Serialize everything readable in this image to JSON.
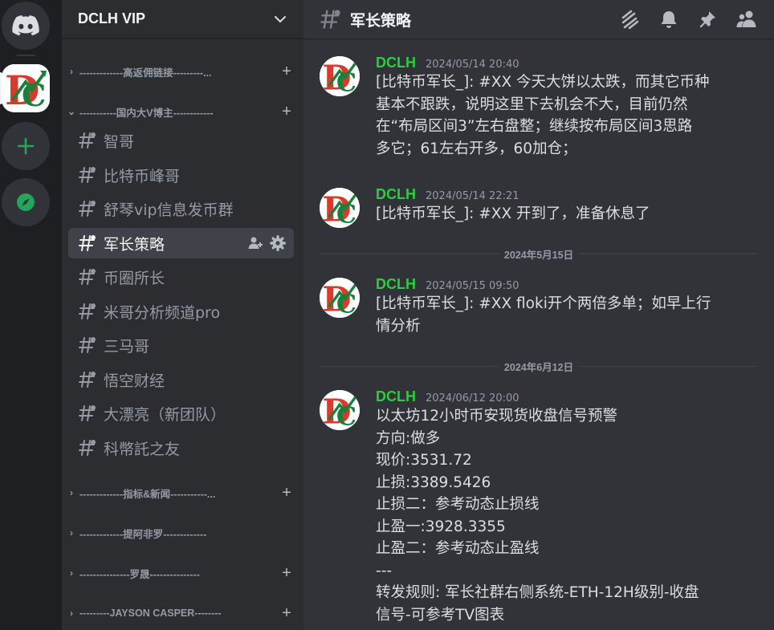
{
  "colors": {
    "accent_green": "#23a55a",
    "author_green": "#2ecc40"
  },
  "rail": {
    "items": [
      {
        "icon": "discord-icon"
      },
      {
        "icon": "server-dclh-logo"
      },
      {
        "icon": "add-server-icon"
      },
      {
        "icon": "explore-compass-icon"
      }
    ]
  },
  "guild": {
    "name": "DCLH VIP",
    "menu_icon": "chevron-down-icon"
  },
  "categories": [
    {
      "label": "-------------高返佣链接---------..."
    },
    {
      "label": "-----------国内大V博主------------"
    },
    {
      "label": "-------------指标&新闻-----------..."
    },
    {
      "label": "-------------提阿非罗-------------"
    },
    {
      "label": "---------------罗晟---------------"
    },
    {
      "label": "---------JAYSON CASPER--------"
    }
  ],
  "channels": [
    {
      "label": "智哥"
    },
    {
      "label": "比特币峰哥"
    },
    {
      "label": "舒琴vip信息发币群"
    },
    {
      "label": "军长策略"
    },
    {
      "label": "币圈所长"
    },
    {
      "label": "米哥分析频道pro"
    },
    {
      "label": "三马哥"
    },
    {
      "label": "悟空财经"
    },
    {
      "label": "大漂亮（新团队）"
    },
    {
      "label": "科幣託之友"
    }
  ],
  "topbar": {
    "title": "军长策略",
    "icons": [
      "threads-icon",
      "notification-bell-icon",
      "pin-icon",
      "member-list-icon"
    ]
  },
  "messages": [
    {
      "author": "DCLH",
      "timestamp": "2024/05/14 20:40",
      "lines": [
        "[比特币军长_]: #XX 今天大饼以太跌，而其它币种",
        "基本不跟跌，说明这里下去机会不大，目前仍然",
        "在“布局区间3”左右盘整；继续按布局区间3思路",
        "多它；61左右开多，60加仓；"
      ]
    },
    {
      "author": "DCLH",
      "timestamp": "2024/05/14 22:21",
      "lines": [
        "[比特币军长_]: #XX 开到了，准备休息了"
      ]
    },
    {
      "author": "DCLH",
      "timestamp": "2024/05/15 09:50",
      "lines": [
        "[比特币军长_]: #XX floki开个两倍多单；如早上行",
        "情分析"
      ]
    },
    {
      "author": "DCLH",
      "timestamp": "2024/06/12 20:00",
      "lines": [
        "以太坊12小时币安现货收盘信号预警",
        "方向:做多",
        "现价:3531.72",
        "止损:3389.5426",
        "止损二：参考动态止损线",
        "止盈一:3928.3355",
        "止盈二：参考动态止盈线",
        "---",
        "转发规则: 军长社群右侧系统-ETH-12H级别-收盘",
        "信号-可参考TV图表"
      ]
    }
  ],
  "dividers": [
    {
      "label": "2024年5月15日"
    },
    {
      "label": "2024年6月12日"
    }
  ]
}
